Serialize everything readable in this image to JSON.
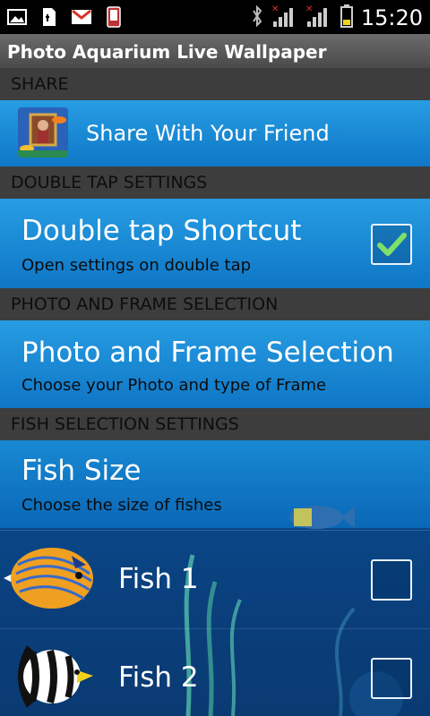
{
  "status_bar": {
    "time": "15:20",
    "icons": [
      "gallery-icon",
      "file-icon",
      "gmail-icon",
      "phone-icon",
      "bluetooth-icon",
      "signal-icon",
      "signal-icon",
      "battery-icon"
    ]
  },
  "title_bar": {
    "title": "Photo Aquarium Live Wallpaper"
  },
  "sections": {
    "share": "SHARE",
    "double_tap": "DOUBLE TAP SETTINGS",
    "photo_frame": "PHOTO AND FRAME SELECTION",
    "fish_selection": "FISH SELECTION SETTINGS"
  },
  "share_item": {
    "label": "Share With Your Friend"
  },
  "double_tap_item": {
    "title": "Double tap Shortcut",
    "summary": "Open settings on double tap",
    "checked": true
  },
  "photo_frame_item": {
    "title": "Photo and Frame Selection",
    "summary": "Choose your Photo and type of Frame"
  },
  "fish_size_item": {
    "title": "Fish Size",
    "summary": "Choose the size of fishes"
  },
  "fish_items": [
    {
      "label": "Fish 1",
      "checked": false
    },
    {
      "label": "Fish 2",
      "checked": false
    }
  ],
  "colors": {
    "accent_check": "#7ee06a",
    "header_bg": "#3d3d3d",
    "row_blue": "#1e8fd8"
  }
}
